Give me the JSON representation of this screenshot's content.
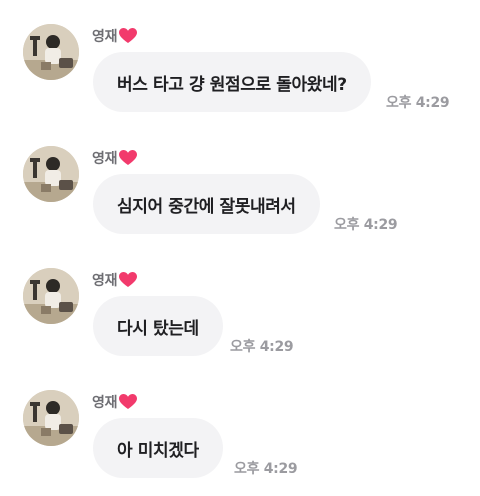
{
  "messages": [
    {
      "sender": "영재",
      "text": "버스 타고 걍 원점으로 돌아왔네?",
      "time": "오후 4:29"
    },
    {
      "sender": "영재",
      "text": "심지어 중간에 잘못내려서",
      "time": "오후 4:29"
    },
    {
      "sender": "영재",
      "text": "다시 탔는데",
      "time": "오후 4:29"
    },
    {
      "sender": "영재",
      "text": "아 미치겠다",
      "time": "오후 4:29"
    }
  ],
  "colors": {
    "bubble": "#f3f3f5",
    "text": "#1f1f22",
    "sender": "#6e6e73",
    "time": "#9b9ba0",
    "heart": "#f23a6c"
  },
  "icons": {
    "heart": "heart-icon",
    "avatar": "profile-photo"
  }
}
